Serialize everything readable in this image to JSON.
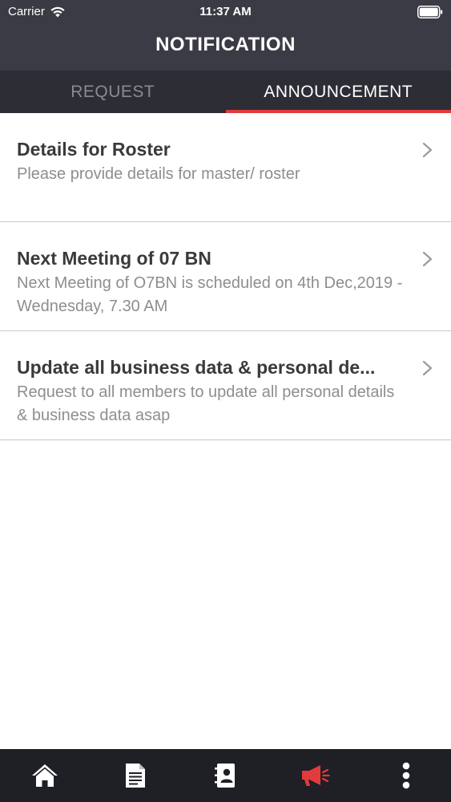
{
  "status_bar": {
    "carrier": "Carrier",
    "time": "11:37 AM",
    "wifi_icon": "wifi-icon",
    "battery_icon": "battery-icon"
  },
  "nav": {
    "title": "NOTIFICATION"
  },
  "tabs": [
    {
      "label": "REQUEST",
      "active": false
    },
    {
      "label": "ANNOUNCEMENT",
      "active": true
    }
  ],
  "colors": {
    "header_bg": "#3b3b45",
    "tabs_bg": "#2d2d35",
    "accent": "#e23b3b",
    "tabbar_bg": "#1f1f26"
  },
  "announcements": [
    {
      "title": "Details for Roster",
      "description": "Please provide details for master/ roster"
    },
    {
      "title": "Next Meeting of 07 BN",
      "description": "Next Meeting of O7BN is scheduled on 4th Dec,2019 - Wednesday, 7.30 AM"
    },
    {
      "title": "Update all business data & personal de...",
      "description": "Request to all members to update all personal details & business data asap"
    }
  ],
  "tabbar": [
    {
      "icon": "home-icon",
      "active": false
    },
    {
      "icon": "document-icon",
      "active": false
    },
    {
      "icon": "contacts-icon",
      "active": false
    },
    {
      "icon": "megaphone-icon",
      "active": true
    },
    {
      "icon": "more-vertical-icon",
      "active": false
    }
  ]
}
